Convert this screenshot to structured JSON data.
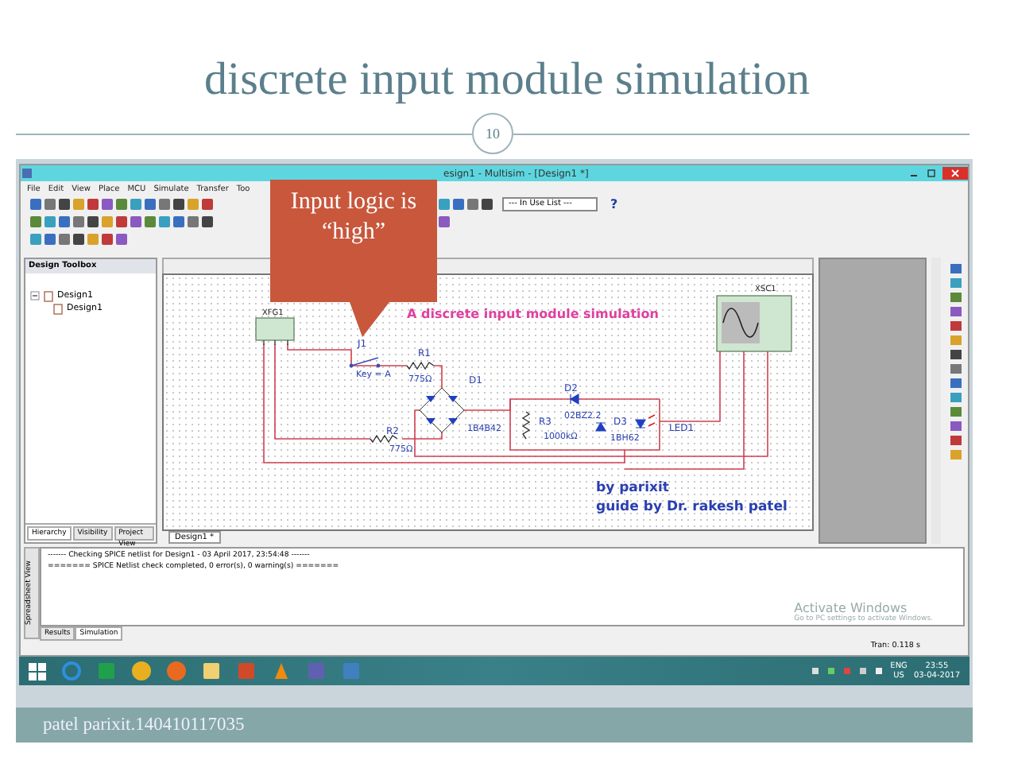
{
  "slide": {
    "title": "discrete input module simulation",
    "page_number": "10",
    "footer": "patel parixit.140410117035"
  },
  "callout": {
    "text": "Input logic is “high”"
  },
  "window": {
    "title": "esign1 - Multisim - [Design1 *]"
  },
  "menu": [
    "File",
    "Edit",
    "View",
    "Place",
    "MCU",
    "Simulate",
    "Transfer",
    "Too"
  ],
  "toolbar": {
    "dropdown": "--- In Use List ---",
    "help": "?"
  },
  "design_toolbox": {
    "title": "Design Toolbox",
    "tree": [
      {
        "label": "Design1",
        "expanded": true,
        "children": [
          {
            "label": "Design1"
          }
        ]
      }
    ],
    "tabs": [
      {
        "label": "Hierarchy",
        "selected": true
      },
      {
        "label": "Visibility",
        "selected": false
      },
      {
        "label": "Project View",
        "selected": false
      }
    ]
  },
  "schematic": {
    "title": "A discrete input module simulation",
    "components": [
      {
        "ref": "XFG1"
      },
      {
        "ref": "J1",
        "value": "Key = A"
      },
      {
        "ref": "R1",
        "value": "775Ω"
      },
      {
        "ref": "D1",
        "value": "1B4B42"
      },
      {
        "ref": "R2",
        "value": "775Ω"
      },
      {
        "ref": "D2",
        "value": "02BZ2.2"
      },
      {
        "ref": "R3",
        "value": "1000kΩ"
      },
      {
        "ref": "D3",
        "value": "1BH62"
      },
      {
        "ref": "LED1"
      },
      {
        "ref": "XSC1"
      }
    ],
    "credits": [
      "by parixit",
      "guide by Dr. rakesh patel"
    ]
  },
  "document_tabs": [
    {
      "label": "Design1 *",
      "selected": true
    }
  ],
  "spreadsheet_view": {
    "side_label": "Spreadsheet View",
    "lines": [
      "------- Checking SPICE netlist for Design1 - 03 April 2017, 23:54:48 -------",
      "======= SPICE Netlist check completed, 0 error(s), 0 warning(s) ======="
    ],
    "tabs": [
      {
        "label": "Results",
        "selected": false
      },
      {
        "label": "Simulation",
        "selected": true
      }
    ]
  },
  "activation_notice": {
    "title": "Activate Windows",
    "hint": "Go to PC settings to activate Windows."
  },
  "status_bar": {
    "reading": "Tran: 0.118 s"
  },
  "taskbar": {
    "tray": {
      "language": "ENG",
      "region": "US",
      "time": "23:55",
      "date": "03-04-2017"
    }
  }
}
